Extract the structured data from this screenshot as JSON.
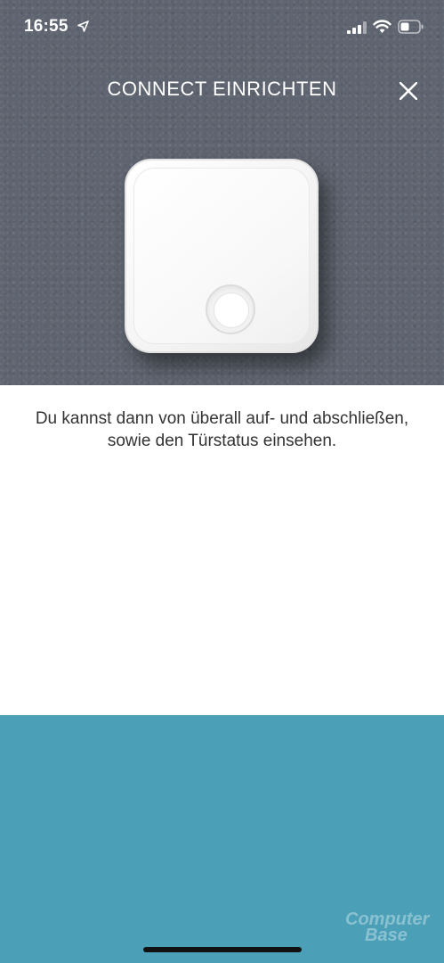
{
  "status_bar": {
    "time": "16:55",
    "icons": [
      "location-arrow-icon",
      "cellular-signal-icon",
      "wifi-icon",
      "battery-icon"
    ]
  },
  "header": {
    "title": "CONNECT EINRICHTEN",
    "close_icon": "close-icon"
  },
  "device": {
    "image": "connect-bridge-device"
  },
  "description": {
    "text": "Du kannst dann von überall auf- und abschließen, sowie den Türstatus einsehen."
  },
  "watermark": {
    "line1": "Computer",
    "line2": "Base"
  },
  "colors": {
    "hero_background": "#5f6570",
    "accent_panel": "#4ba0b8",
    "body_text": "#333333"
  }
}
